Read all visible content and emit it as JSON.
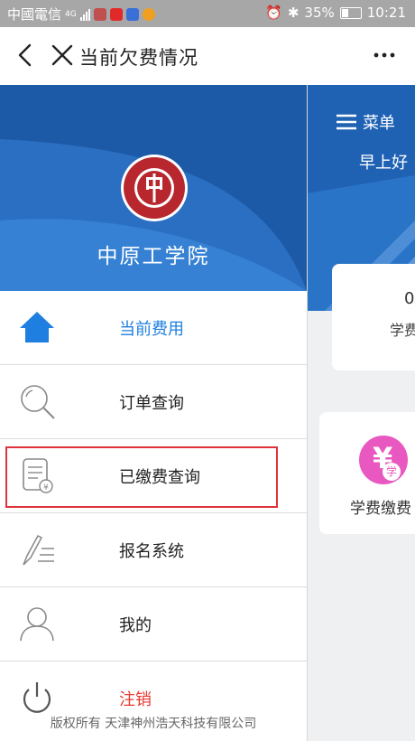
{
  "status_bar": {
    "carrier": "中國電信",
    "signal_label": "4G",
    "battery_percent": "35%",
    "time": "10:21"
  },
  "title_bar": {
    "title": "当前欠费情况"
  },
  "drawer": {
    "school_name": "中原工学院",
    "items": [
      {
        "label": "当前费用",
        "icon": "home-icon"
      },
      {
        "label": "订单查询",
        "icon": "search-icon"
      },
      {
        "label": "已缴费查询",
        "icon": "receipt-yuan-icon"
      },
      {
        "label": "报名系统",
        "icon": "pen-list-icon"
      },
      {
        "label": "我的",
        "icon": "user-icon"
      },
      {
        "label": "注销",
        "icon": "power-icon"
      }
    ],
    "copyright": "版权所有 天津神州浩天科技有限公司"
  },
  "background_page": {
    "menu_label": "菜单",
    "greeting": "早上好",
    "card_value": "0",
    "card_label": "学费",
    "tile_label": "学费缴费",
    "tile_icon_char": "¥",
    "tile_badge_char": "学"
  },
  "colors": {
    "accent": "#1e7fe0",
    "banner": "#2265b8",
    "logout": "#e8382f",
    "highlight": "#e0323a",
    "status_bar": "#a7a7a7"
  }
}
